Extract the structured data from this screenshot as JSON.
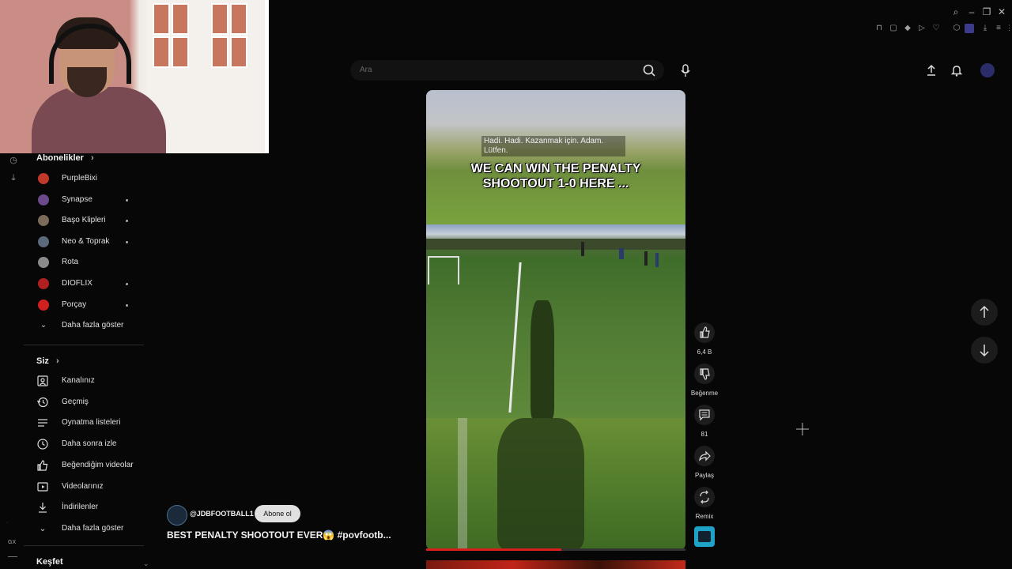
{
  "search": {
    "placeholder": "Ara"
  },
  "sidebar": {
    "subscriptions_title": "Abonelikler",
    "subscriptions": [
      {
        "label": "PurpleBixi",
        "color": "#c0392b",
        "new": false
      },
      {
        "label": "Synapse",
        "color": "#6a4a8a",
        "new": true
      },
      {
        "label": "Başo Klipleri",
        "color": "#7a6a5a",
        "new": true
      },
      {
        "label": "Neo & Toprak",
        "color": "#5a6a7a",
        "new": true
      },
      {
        "label": "Rota",
        "color": "#8a8a8a",
        "new": false
      },
      {
        "label": "DIOFLIX",
        "color": "#b02020",
        "new": true
      },
      {
        "label": "Porçay",
        "color": "#d02020",
        "new": true
      }
    ],
    "show_more_1": "Daha fazla göster",
    "you_title": "Siz",
    "you_items": [
      {
        "label": "Kanalınız",
        "icon": "channel-icon"
      },
      {
        "label": "Geçmiş",
        "icon": "history-icon"
      },
      {
        "label": "Oynatma listeleri",
        "icon": "playlist-icon"
      },
      {
        "label": "Daha sonra izle",
        "icon": "clock-icon"
      },
      {
        "label": "Beğendiğim videolar",
        "icon": "thumb-up-icon"
      },
      {
        "label": "Videolarınız",
        "icon": "video-icon"
      },
      {
        "label": "İndirilenler",
        "icon": "download-icon"
      }
    ],
    "show_more_2": "Daha fazla göster",
    "explore_title": "Keşfet",
    "rail_label": "GX"
  },
  "video": {
    "translated_caption": "Hadi. Hadi. Kazanmak için. Adam. Lütfen.",
    "overlay_line1": "WE CAN WIN THE PENALTY",
    "overlay_line2": "SHOOTOUT 1-0 HERE ...",
    "progress": 0.52
  },
  "actions": {
    "like_count": "6,4 B",
    "dislike_label": "Beğenme",
    "comment_count": "81",
    "share_label": "Paylaş",
    "remix_label": "Remix"
  },
  "channel": {
    "handle": "@JDBFOOTBALL1",
    "subscribe_label": "Abone ol",
    "title": "BEST PENALTY SHOOTOUT EVER😱 #povfootb..."
  }
}
